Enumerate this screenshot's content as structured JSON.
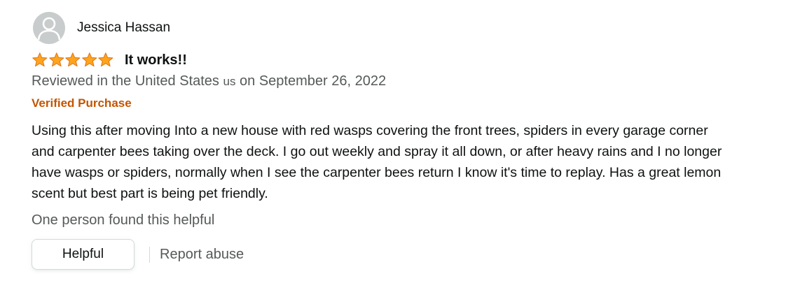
{
  "profile": {
    "name": "Jessica Hassan",
    "avatar_icon": "default-avatar-icon"
  },
  "rating": {
    "value": 5,
    "max": 5,
    "star_color": "#ffa41c",
    "star_stroke": "#de7921"
  },
  "review": {
    "title": "It works!!",
    "date_prefix": "Reviewed in the United States",
    "country_code": "us",
    "date_suffix": "on September 26, 2022",
    "verified_label": "Verified Purchase",
    "body": "Using this after moving Into a new house with red wasps covering the front trees, spiders in every garage corner and carpenter bees taking over the deck. I go out weekly and spray it all down, or after heavy rains and I no longer have wasps or spiders, normally when I see the carpenter bees return I know it's time to replay. Has a great lemon scent but best part is being pet friendly.",
    "helpful_count_text": "One person found this helpful"
  },
  "actions": {
    "helpful_label": "Helpful",
    "report_label": "Report abuse"
  },
  "colors": {
    "text": "#0f1111",
    "secondary_text": "#565959",
    "verified": "#c45500",
    "button_border": "#d5d9d9",
    "avatar_bg": "#c9cccc"
  }
}
